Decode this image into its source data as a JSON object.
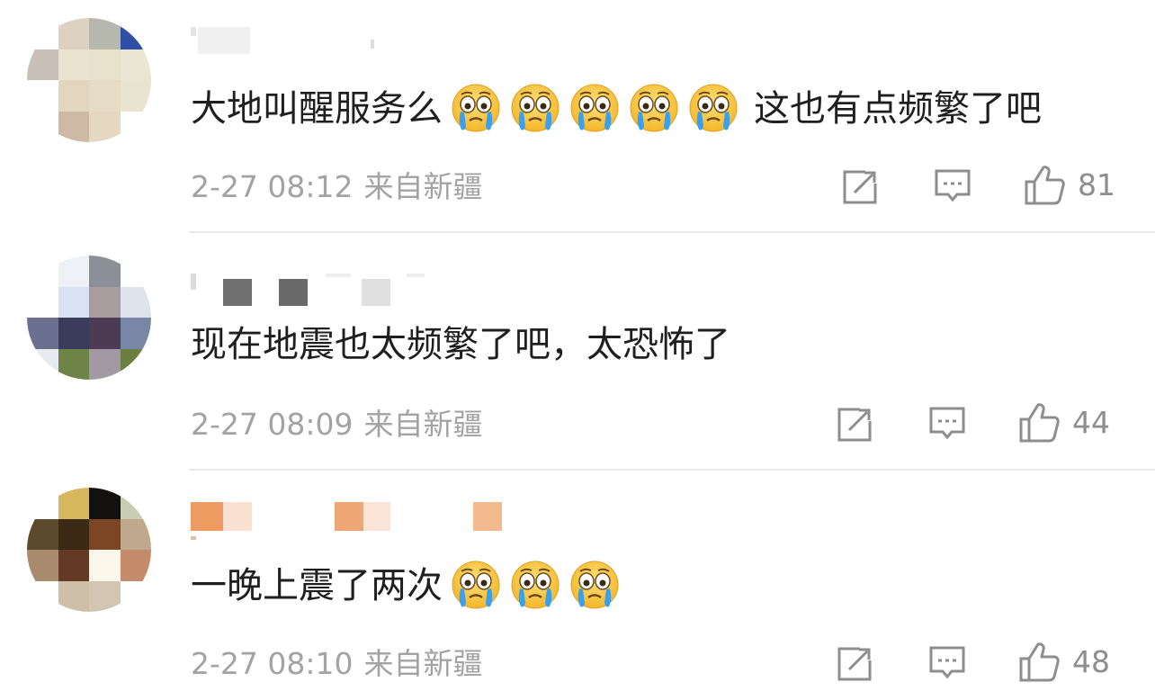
{
  "comments": [
    {
      "text_before": "大地叫醒服务么",
      "emoji_count": 5,
      "text_after": "这也有点频繁了吧",
      "time": "2-27 08:12",
      "source": "来自新疆",
      "likes": "81"
    },
    {
      "text_before": "现在地震也太频繁了吧，太恐怖了",
      "emoji_count": 0,
      "text_after": "",
      "time": "2-27 08:09",
      "source": "来自新疆",
      "likes": "44"
    },
    {
      "text_before": "一晚上震了两次",
      "emoji_count": 3,
      "text_after": "",
      "time": "2-27 08:10",
      "source": "来自新疆",
      "likes": "48"
    }
  ],
  "icons": {
    "share": "share-icon",
    "comment": "comment-icon",
    "like": "thumbs-up-icon",
    "emoji": "crying-face-emoji"
  },
  "colors": {
    "meta_text": "#a3a3a3",
    "icon": "#8e8e8e",
    "divider": "#e9e9e9"
  }
}
